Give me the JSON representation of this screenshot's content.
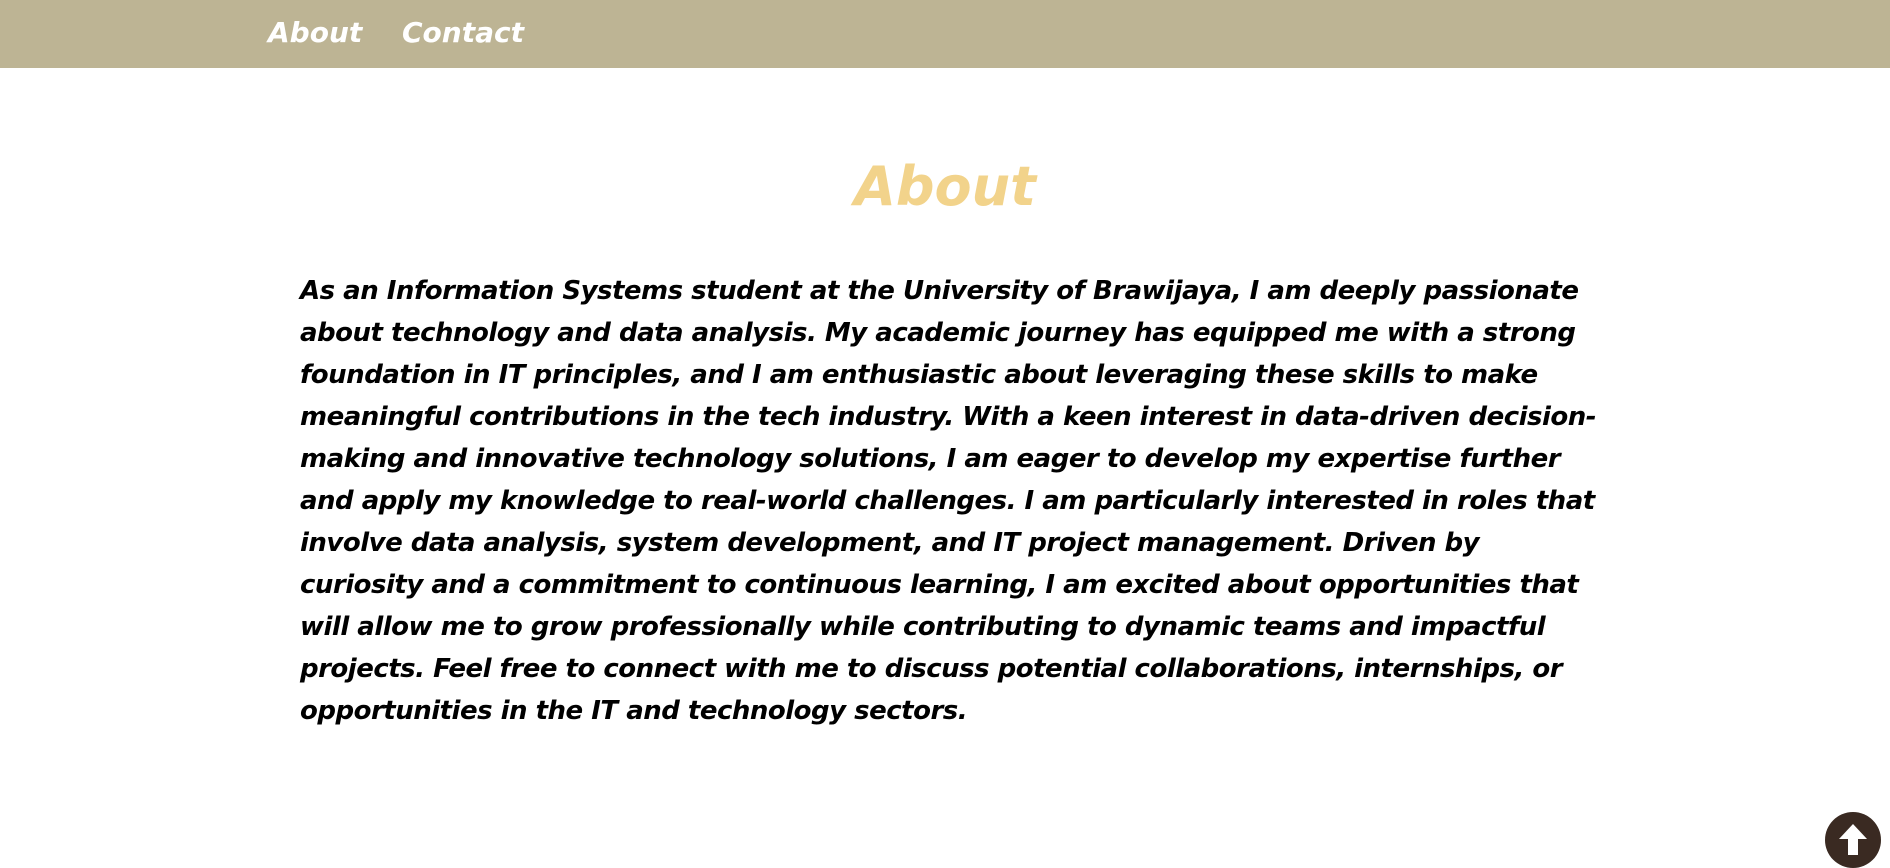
{
  "nav": {
    "about_label": "About",
    "contact_label": "Contact",
    "background": "#bdb494"
  },
  "about": {
    "title": "About",
    "title_color": "#f2d38b",
    "body": "As an Information Systems student at the University of Brawijaya, I am deeply passionate about technology and data analysis. My academic journey has equipped me with a strong foundation in IT principles, and I am enthusiastic about leveraging these skills to make meaningful contributions in the tech industry. With a keen interest in data-driven decision-making and innovative technology solutions, I am eager to develop my expertise further and apply my knowledge to real-world challenges. I am particularly interested in roles that involve data analysis, system development, and IT project management. Driven by curiosity and a commitment to continuous learning, I am excited about opportunities that will allow me to grow professionally while contributing to dynamic teams and impactful projects. Feel free to connect with me to discuss potential collaborations, internships, or opportunities in the IT and technology sectors."
  },
  "scroll_top": {
    "icon": "arrow-up-icon",
    "color": "#3a2a22"
  }
}
